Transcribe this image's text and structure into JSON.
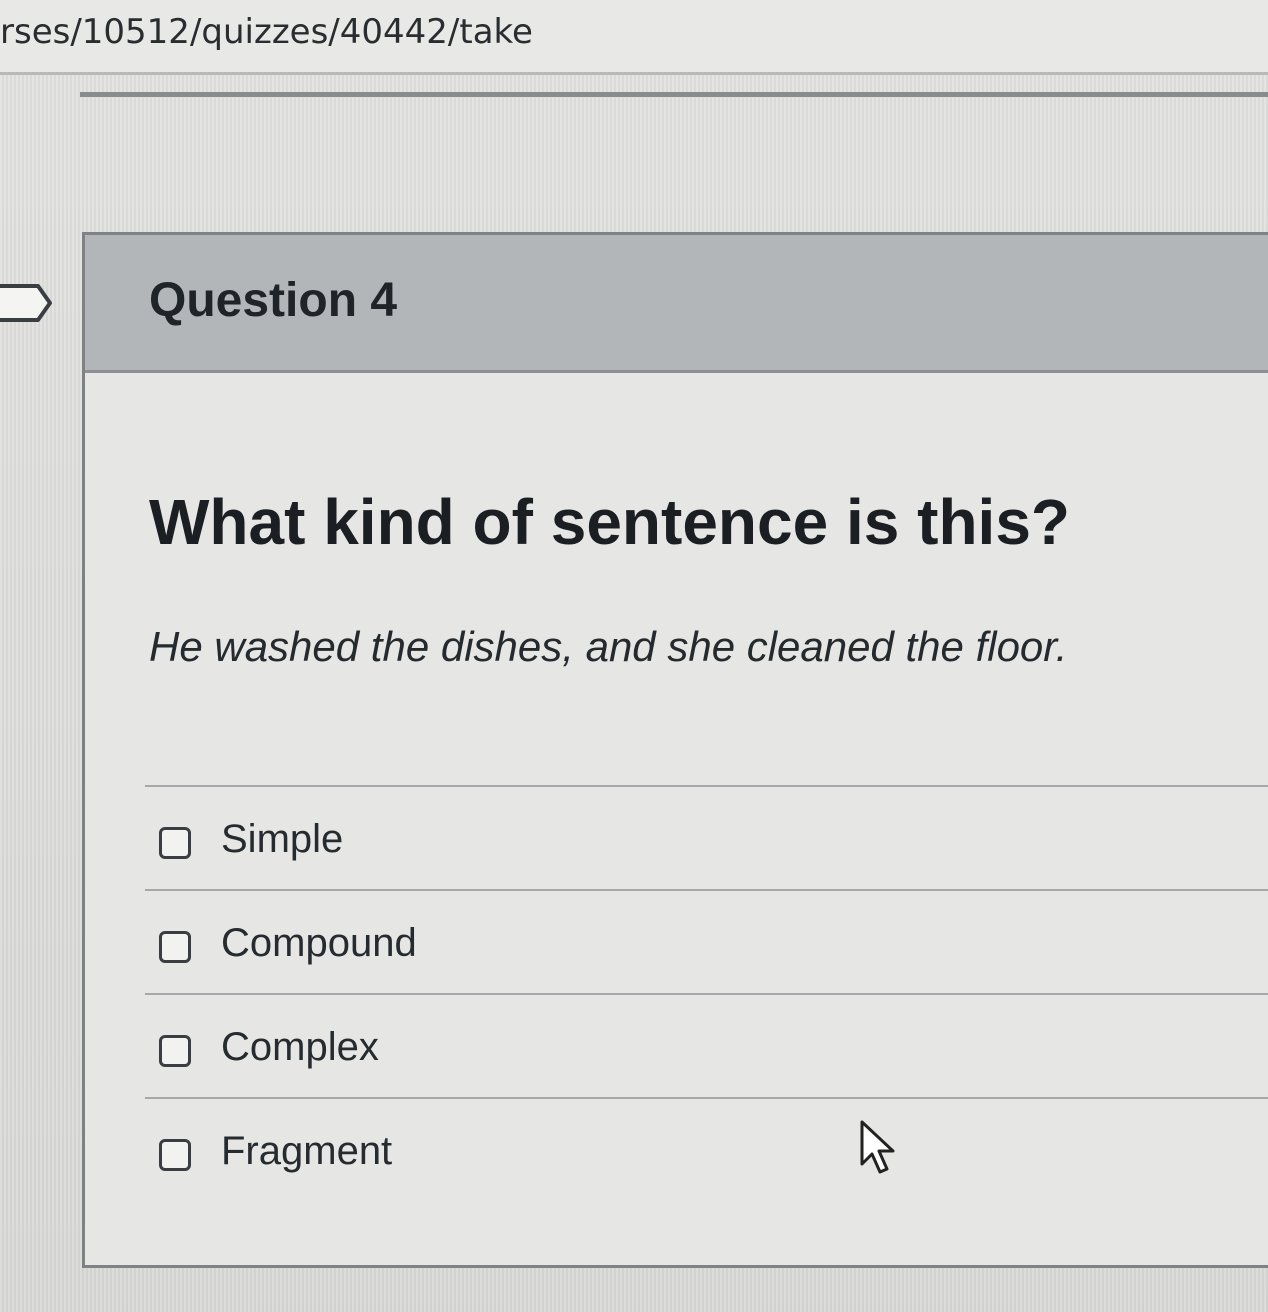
{
  "address_bar": {
    "url_fragment": "rses/10512/quizzes/40442/take"
  },
  "question": {
    "title": "Question 4",
    "prompt": "What kind of sentence is this?",
    "sentence": "He washed the dishes, and she cleaned the floor.",
    "answers": [
      {
        "label": "Simple",
        "checked": false
      },
      {
        "label": "Compound",
        "checked": false
      },
      {
        "label": "Complex",
        "checked": false
      },
      {
        "label": "Fragment",
        "checked": false
      }
    ]
  },
  "icons": {
    "flag": "flag-icon",
    "cursor": "mouse-pointer-icon"
  }
}
